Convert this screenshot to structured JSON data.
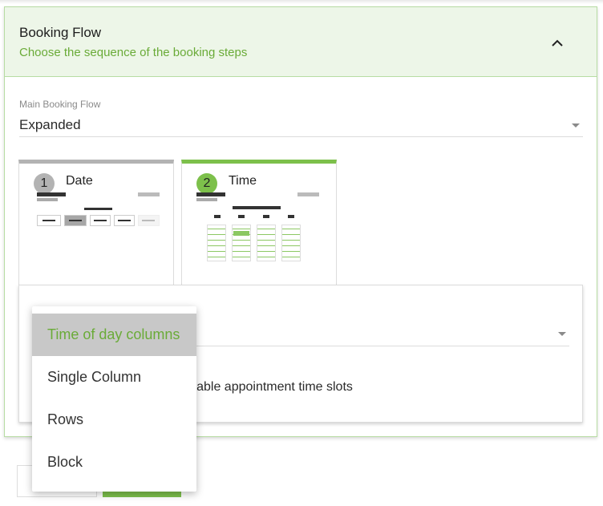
{
  "section": {
    "title": "Booking Flow",
    "subtitle": "Choose the sequence of the booking steps",
    "collapse_icon": "chevron-up-icon"
  },
  "main_flow": {
    "label": "Main Booking Flow",
    "value": "Expanded"
  },
  "steps": [
    {
      "number": "1",
      "label": "Date",
      "color": "#b3b3b3"
    },
    {
      "number": "2",
      "label": "Time",
      "color": "#7dc04b"
    }
  ],
  "settings": {
    "option_text": "ilable appointment time slots"
  },
  "dropdown": {
    "options": [
      "Time of day columns",
      "Single Column",
      "Rows",
      "Block"
    ],
    "selected": "Time of day columns"
  },
  "colors": {
    "accent": "#7dc04b",
    "accent_text": "#6aab38",
    "header_bg": "#edf6e8"
  }
}
